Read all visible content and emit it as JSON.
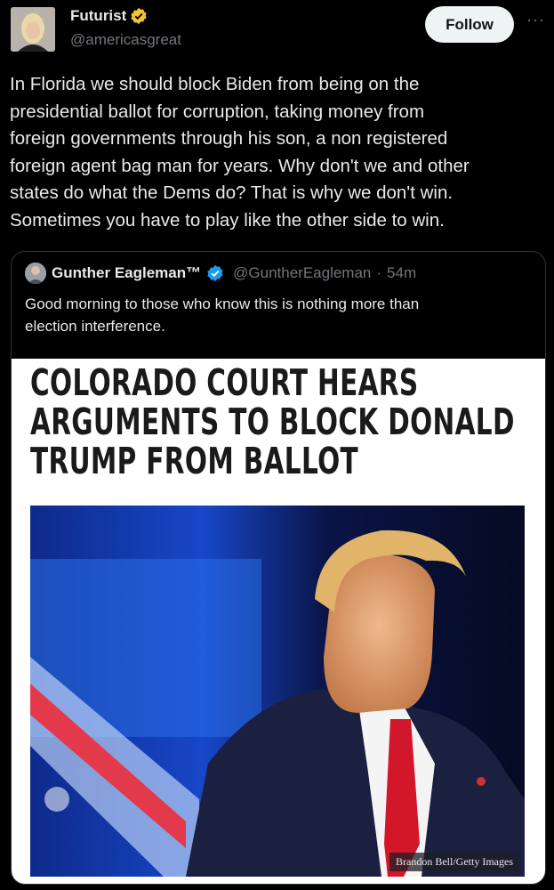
{
  "author": {
    "name": "Futurist",
    "handle": "@americasgreat",
    "follow_label": "Follow",
    "more_glyph": "···",
    "verified_color": "#f4c430"
  },
  "post": {
    "lines": [
      "In Florida we should block Biden from being on the",
      "presidential ballot for corruption, taking money from",
      "foreign governments through his son, a non registered",
      "foreign agent bag man for years.  Why don't we and other",
      "states do what the Dems do? That is why we don't win.",
      "Sometimes you have to play like the other side to win."
    ]
  },
  "quoted": {
    "name": "Gunther Eagleman™",
    "handle": "@GuntherEagleman",
    "separator": "·",
    "time": "54m",
    "verified_color": "#1d9bf0",
    "text_lines": [
      "Good morning to those who know this is nothing more than",
      "election interference."
    ],
    "media": {
      "headline_lines": [
        "COLORADO COURT HEARS",
        "ARGUMENTS TO BLOCK DONALD",
        "TRUMP FROM BALLOT"
      ],
      "photo_credit": "Brandon Bell/Getty Images"
    }
  }
}
